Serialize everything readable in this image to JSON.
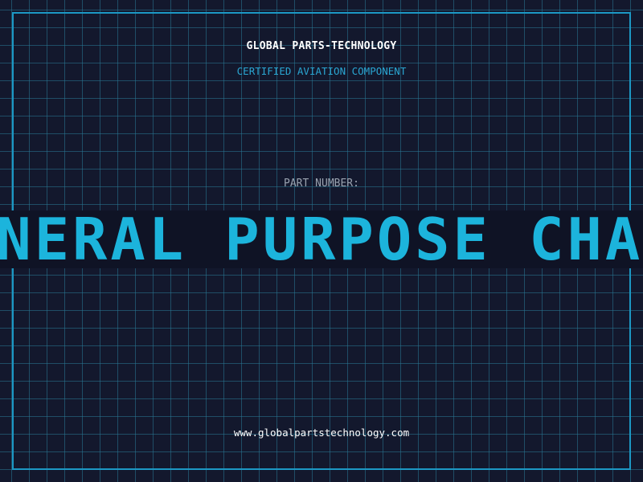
{
  "header": {
    "brand": "GLOBAL PARTS-TECHNOLOGY",
    "subtitle": "CERTIFIED AVIATION COMPONENT"
  },
  "part": {
    "label": "PART NUMBER:",
    "value": "ENERAL PURPOSE CHA"
  },
  "footer": {
    "url": "www.globalpartstechnology.com"
  },
  "colors": {
    "background": "#13182d",
    "grid": "#287896",
    "accent": "#1cb4dc",
    "frame": "#1c98c4"
  }
}
